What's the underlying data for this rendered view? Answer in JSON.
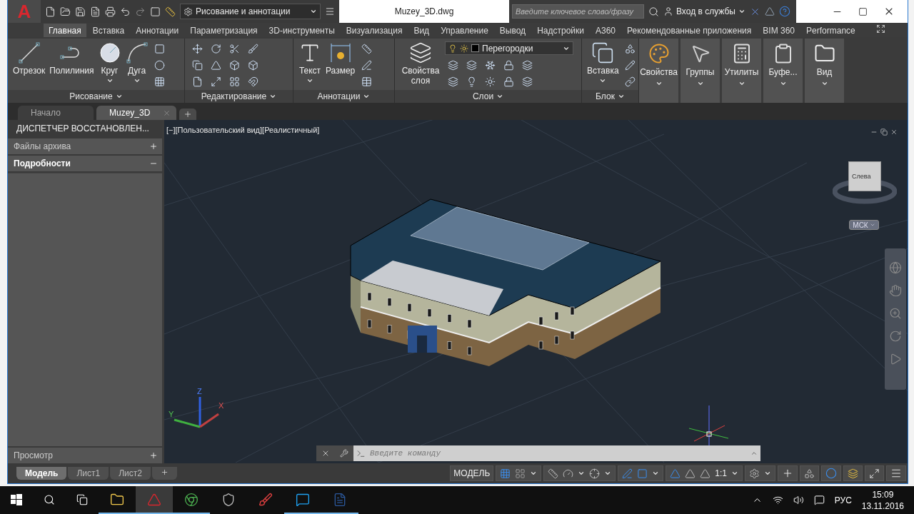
{
  "title_bar": {
    "app_button": "A",
    "workspace": "Рисование и аннотации",
    "title": "Muzey_3D.dwg",
    "search": {
      "placeholder": "Введите ключевое слово/фразу"
    },
    "sign_in": "Вход в службы"
  },
  "ribbon_tabs": [
    {
      "label": "Главная",
      "selected": true
    },
    {
      "label": "Вставка",
      "selected": false
    },
    {
      "label": "Аннотации",
      "selected": false
    },
    {
      "label": "Параметризация",
      "selected": false
    },
    {
      "label": "3D-инструменты",
      "selected": false
    },
    {
      "label": "Визуализация",
      "selected": false
    },
    {
      "label": "Вид",
      "selected": false
    },
    {
      "label": "Управление",
      "selected": false
    },
    {
      "label": "Вывод",
      "selected": false
    },
    {
      "label": "Надстройки",
      "selected": false
    },
    {
      "label": "A360",
      "selected": false
    },
    {
      "label": "Рекомендованные приложения",
      "selected": false
    },
    {
      "label": "BIM 360",
      "selected": false
    },
    {
      "label": "Performance",
      "selected": false
    }
  ],
  "ribbon_panels": [
    {
      "kind": "tools",
      "title": "Рисование",
      "tools": [
        "Отрезок",
        "Полилиния",
        "Круг",
        "Дуга"
      ]
    },
    {
      "kind": "tools",
      "title": "Редактирование"
    },
    {
      "kind": "tools",
      "title": "Аннотации",
      "tools": [
        "Текст",
        "Размер"
      ]
    },
    {
      "kind": "layers",
      "title": "Слои",
      "tools": [
        "Свойства слоя"
      ],
      "layer": "Перегородки"
    },
    {
      "kind": "tools",
      "title": "Блок",
      "tools": [
        "Вставка"
      ]
    },
    {
      "kind": "collapsed",
      "title": "Свойства"
    },
    {
      "kind": "collapsed",
      "title": "Группы"
    },
    {
      "kind": "collapsed",
      "title": "Утилиты"
    },
    {
      "kind": "collapsed",
      "title": "Буфе..."
    },
    {
      "kind": "collapsed",
      "title": "Вид"
    }
  ],
  "doc_tabs": [
    {
      "label": "Начало",
      "selected": false
    },
    {
      "label": "Muzey_3D",
      "selected": true
    }
  ],
  "left_panel": {
    "header": "ДИСПЕТЧЕР ВОССТАНОВЛЕН...",
    "sections": [
      {
        "label": "Файлы архива",
        "expanded": false
      },
      {
        "label": "Подробности",
        "expanded": true
      },
      {
        "label": "Просмотр",
        "expanded": false
      }
    ]
  },
  "viewport": {
    "label": "[−][Пользовательский вид][Реалистичный]",
    "viewcube_face": "Слева",
    "ucs_menu": "МСК",
    "axes": [
      "Z",
      "X",
      "Y"
    ]
  },
  "command_line": {
    "placeholder": "Введите команду"
  },
  "layout_tabs": [
    {
      "label": "Модель",
      "selected": true
    },
    {
      "label": "Лист1",
      "selected": false
    },
    {
      "label": "Лист2",
      "selected": false
    }
  ],
  "status_bar": {
    "model": "МОДЕЛЬ",
    "scale": "1:1"
  },
  "taskbar": {
    "apps": [
      {
        "selected": false,
        "running": true
      },
      {
        "selected": true,
        "running": true
      },
      {
        "selected": false,
        "running": true
      },
      {
        "selected": false,
        "running": false
      },
      {
        "selected": false,
        "running": false
      },
      {
        "selected": false,
        "running": true
      },
      {
        "selected": false,
        "running": true
      }
    ],
    "language": "РУС",
    "time": "15:09",
    "date": "13.11.2016"
  }
}
